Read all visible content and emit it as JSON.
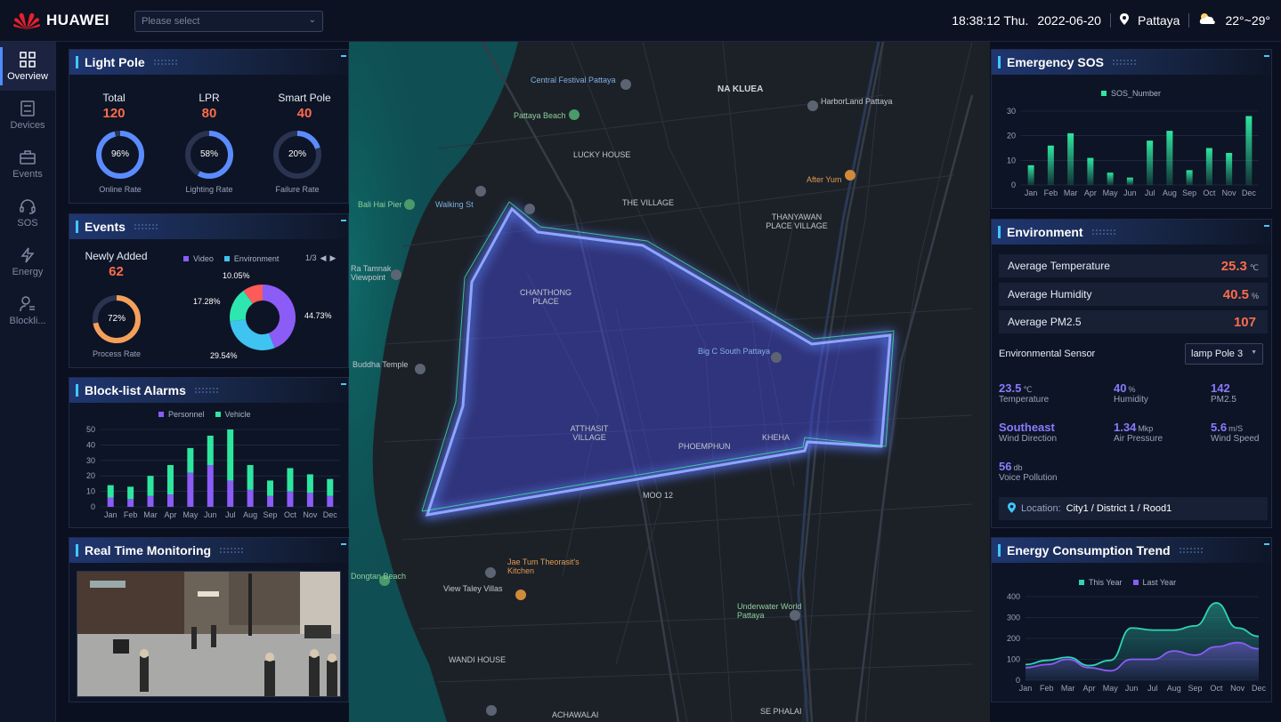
{
  "header": {
    "brand": "HUAWEI",
    "select_placeholder": "Please select",
    "time": "18:38:12",
    "day": "Thu.",
    "date": "2022-06-20",
    "city": "Pattaya",
    "temperature_range": "22°~29°"
  },
  "sidebar": {
    "items": [
      {
        "label": "Overview",
        "icon": "grid-icon"
      },
      {
        "label": "Devices",
        "icon": "device-icon"
      },
      {
        "label": "Events",
        "icon": "briefcase-icon"
      },
      {
        "label": "SOS",
        "icon": "headset-icon"
      },
      {
        "label": "Energy",
        "icon": "lightning-icon"
      },
      {
        "label": "Blockli...",
        "icon": "user-list-icon"
      }
    ]
  },
  "light_pole": {
    "title": "Light Pole",
    "stats": [
      {
        "label": "Total",
        "value": "120",
        "ring": "96%",
        "ring_fraction": 0.96,
        "caption": "Online Rate"
      },
      {
        "label": "LPR",
        "value": "80",
        "ring": "58%",
        "ring_fraction": 0.58,
        "caption": "Lighting Rate"
      },
      {
        "label": "Smart Pole",
        "value": "40",
        "ring": "20%",
        "ring_fraction": 0.2,
        "caption": "Failure Rate"
      }
    ]
  },
  "events": {
    "title": "Events",
    "newly_added_label": "Newly Added",
    "newly_added_value": "62",
    "process_ring": "72%",
    "process_fraction": 0.72,
    "process_caption": "Process Rate",
    "legend": [
      "Video",
      "Environment"
    ],
    "pager": "1/3",
    "donut": [
      {
        "label": "44.73%",
        "value": 44.73,
        "color": "#8b5cf6"
      },
      {
        "label": "29.54%",
        "value": 29.54,
        "color": "#3fc3f0"
      },
      {
        "label": "17.28%",
        "value": 17.28,
        "color": "#2ee6b0"
      },
      {
        "label": "10.05%",
        "value": 10.05,
        "color": "#ff5a5a"
      }
    ]
  },
  "blocklist": {
    "title": "Block-list Alarms",
    "legend": [
      "Personnel",
      "Vehicle"
    ]
  },
  "monitoring": {
    "title": "Real Time Monitoring"
  },
  "sos": {
    "title": "Emergency SOS",
    "legend": "SOS_Number"
  },
  "environment": {
    "title": "Environment",
    "rows": [
      {
        "label": "Average Temperature",
        "value": "25.3",
        "unit": "℃"
      },
      {
        "label": "Average Humidity",
        "value": "40.5",
        "unit": "%"
      },
      {
        "label": "Average PM2.5",
        "value": "107",
        "unit": ""
      }
    ],
    "sensor_label": "Environmental Sensor",
    "sensor_select": "lamp Pole 3",
    "sensors": [
      {
        "value": "23.5",
        "unit": "℃",
        "label": "Temperature"
      },
      {
        "value": "40",
        "unit": "%",
        "label": "Humidity"
      },
      {
        "value": "142",
        "unit": "",
        "label": "PM2.5"
      },
      {
        "value": "Southeast",
        "unit": "",
        "label": "Wind Direction"
      },
      {
        "value": "1.34",
        "unit": "Mkp",
        "label": "Air Pressure"
      },
      {
        "value": "5.6",
        "unit": "m/S",
        "label": "Wind Speed"
      },
      {
        "value": "56",
        "unit": "db",
        "label": "Voice Pollution"
      }
    ],
    "location_label": "Location:",
    "location_value": "City1 / District 1 / Rood1"
  },
  "energy": {
    "title": "Energy Consumption Trend",
    "legend": [
      "This Year",
      "Last Year"
    ]
  },
  "map": {
    "labels": [
      "Central Festival Pattaya",
      "NA KLUEA",
      "HarborLand Pattaya",
      "Pattaya Beach",
      "LUCKY HOUSE",
      "Bali Hai Pier",
      "Walking St",
      "THE VILLAGE",
      "THANYAWAN PLACE VILLAGE",
      "After Yum",
      "CHANTHONG PLACE",
      "Big C South Pattaya",
      "ATTHASIT VILLAGE",
      "PHOEMPHUN",
      "KHEHA",
      "MOO 12",
      "Jae Tum Theorasit's Kitchen",
      "View Taley Villas",
      "Underwater World Pattaya",
      "WANDI HOUSE",
      "ACHAWALAI",
      "SE PHALAI",
      "Ra Tamnak Viewpoint",
      "Buddha Temple",
      "Dongtan Beach"
    ]
  },
  "chart_data": [
    {
      "type": "bar",
      "title": "Block-list Alarms",
      "categories": [
        "Jan",
        "Feb",
        "Mar",
        "Apr",
        "May",
        "Jun",
        "Jul",
        "Aug",
        "Sep",
        "Oct",
        "Nov",
        "Dec"
      ],
      "series": [
        {
          "name": "Personnel",
          "values": [
            6,
            5,
            7,
            8,
            22,
            27,
            17,
            11,
            7,
            10,
            9,
            7
          ]
        },
        {
          "name": "Vehicle",
          "values": [
            8,
            8,
            13,
            19,
            16,
            19,
            33,
            16,
            10,
            15,
            12,
            11
          ]
        }
      ],
      "stacked": true,
      "ylim": [
        0,
        50
      ],
      "yticks": [
        0,
        10,
        20,
        30,
        40,
        50
      ],
      "colors": [
        "#8b5cf6",
        "#2ee6a0"
      ]
    },
    {
      "type": "bar",
      "title": "Emergency SOS",
      "categories": [
        "Jan",
        "Feb",
        "Mar",
        "Apr",
        "May",
        "Jun",
        "Jul",
        "Aug",
        "Sep",
        "Oct",
        "Nov",
        "Dec"
      ],
      "series": [
        {
          "name": "SOS_Number",
          "values": [
            8,
            16,
            21,
            11,
            5,
            3,
            18,
            22,
            6,
            15,
            13,
            28
          ]
        }
      ],
      "ylim": [
        0,
        30
      ],
      "yticks": [
        0,
        10,
        20,
        30
      ],
      "colors": [
        "#2ee6a0"
      ]
    },
    {
      "type": "area",
      "title": "Energy Consumption Trend",
      "categories": [
        "Jan",
        "Feb",
        "Mar",
        "Apr",
        "May",
        "Jun",
        "Jul",
        "Aug",
        "Sep",
        "Oct",
        "Nov",
        "Dec"
      ],
      "series": [
        {
          "name": "This Year",
          "values": [
            75,
            95,
            110,
            70,
            95,
            250,
            240,
            240,
            260,
            370,
            250,
            210
          ]
        },
        {
          "name": "Last Year",
          "values": [
            60,
            75,
            100,
            60,
            45,
            100,
            100,
            140,
            120,
            160,
            180,
            150
          ]
        }
      ],
      "ylim": [
        0,
        400
      ],
      "yticks": [
        0,
        100,
        200,
        300,
        400
      ],
      "colors": [
        "#2fd3b8",
        "#8b5cf6"
      ]
    }
  ]
}
